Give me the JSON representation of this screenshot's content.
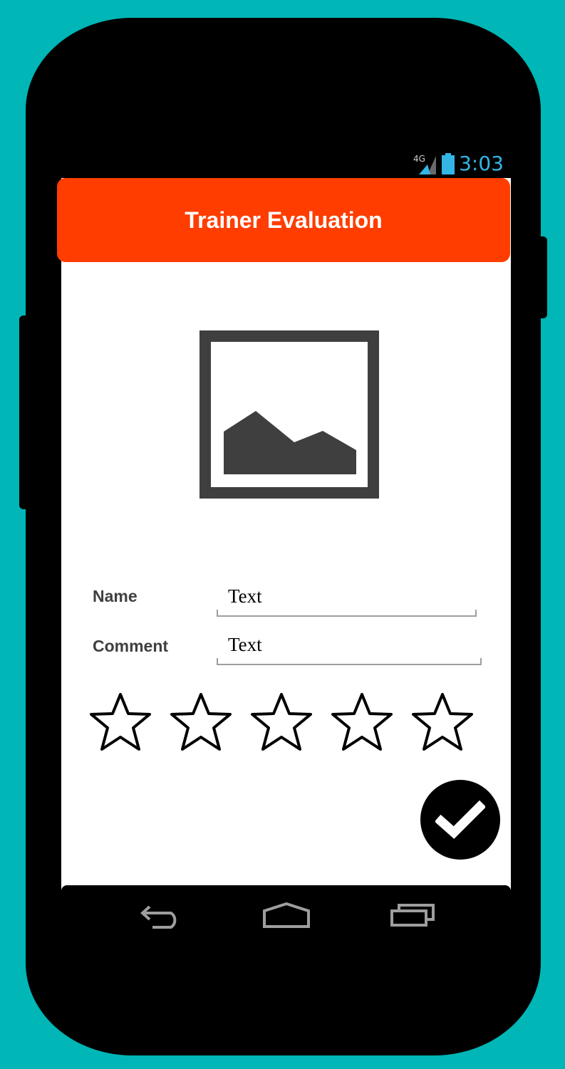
{
  "status_bar": {
    "network_label": "4G",
    "time": "3:03",
    "time_color": "#33b5e5"
  },
  "app_bar": {
    "title": "Trainer Evaluation",
    "color": "#ff3d00"
  },
  "form": {
    "name_label": "Name",
    "name_value": "Text",
    "comment_label": "Comment",
    "comment_value": "Text"
  },
  "rating": {
    "max": 5,
    "value": 0
  },
  "icons": {
    "image": "image-placeholder-icon",
    "star": "star-outline-icon",
    "submit": "checkmark-icon",
    "back": "back-icon",
    "home": "home-icon",
    "recents": "recent-apps-icon"
  }
}
